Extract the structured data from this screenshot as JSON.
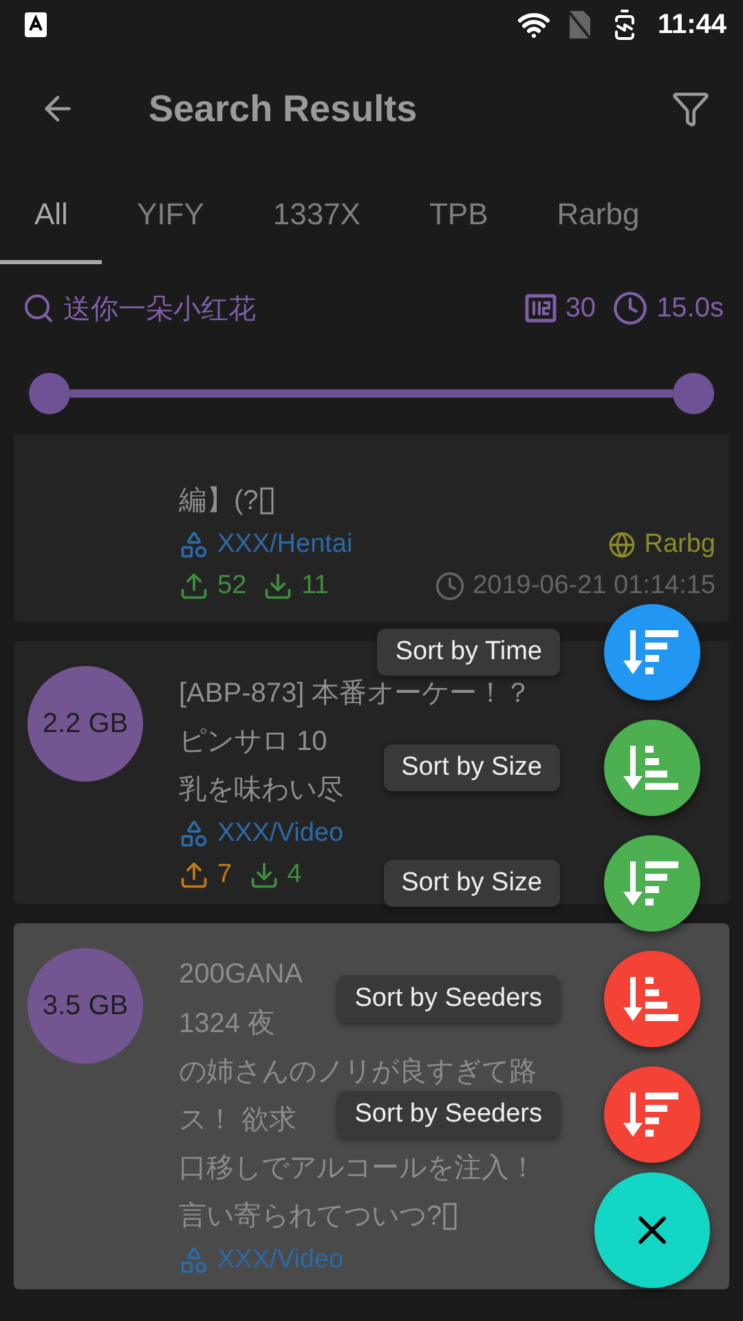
{
  "status_bar": {
    "time": "11:44"
  },
  "app_bar": {
    "title": "Search Results"
  },
  "tabs": [
    {
      "label": "All",
      "selected": true
    },
    {
      "label": "YIFY",
      "selected": false
    },
    {
      "label": "1337X",
      "selected": false
    },
    {
      "label": "TPB",
      "selected": false
    },
    {
      "label": "Rarbg",
      "selected": false
    }
  ],
  "search_summary": {
    "query": "送你一朵小红花",
    "count": "30",
    "duration": "15.0s"
  },
  "range_slider": {
    "thumbs": [
      {
        "level": 0
      },
      {
        "level": 1
      }
    ]
  },
  "results": [
    {
      "title_lines": [
        {
          "text": "編】(?",
          "missing_glyph": true
        }
      ],
      "category": "XXX/Hentai",
      "source": "Rarbg",
      "seeders": {
        "value": "52",
        "color": "#3f8f3f"
      },
      "leechers": {
        "value": "11",
        "color": "#3f8f3f"
      },
      "date": "2019-06-21 01:14:15",
      "selected": false
    },
    {
      "size": "2.2 GB",
      "title_lines": [
        {
          "text": "[ABP-873] 本番オーケー！？"
        },
        {
          "text": "ピンサロ 10"
        },
        {
          "text": "乳を味わい尽"
        }
      ],
      "category": "XXX/Video",
      "seeders": {
        "value": "7",
        "color": "#c47a14"
      },
      "leechers": {
        "value": "4",
        "color": "#3f8f3f"
      },
      "selected": false
    },
    {
      "size": "3.5 GB",
      "title_lines": [
        {
          "text": "200GANA"
        },
        {
          "text": "1324 夜"
        },
        {
          "text": "の姉さんのノリが良すぎて路"
        },
        {
          "text": "ス！ 欲求"
        },
        {
          "text": "口移しでアルコールを注入！"
        },
        {
          "text": "言い寄られてついつ?",
          "missing_glyph": true
        }
      ],
      "category": "XXX/Video",
      "selected": true
    }
  ],
  "speed_dial": {
    "open": true,
    "actions": [
      {
        "label": "Sort by Time",
        "color": "#2196f3",
        "kind": "descending"
      },
      {
        "label": "Sort by Size",
        "color": "#4caf50",
        "kind": "ascending"
      },
      {
        "label": "Sort by Size",
        "color": "#4caf50",
        "kind": "descending"
      },
      {
        "label": "Sort by Seeders",
        "color": "#f44336",
        "kind": "ascending"
      },
      {
        "label": "Sort by Seeders",
        "color": "#f44336",
        "kind": "descending"
      }
    ]
  }
}
